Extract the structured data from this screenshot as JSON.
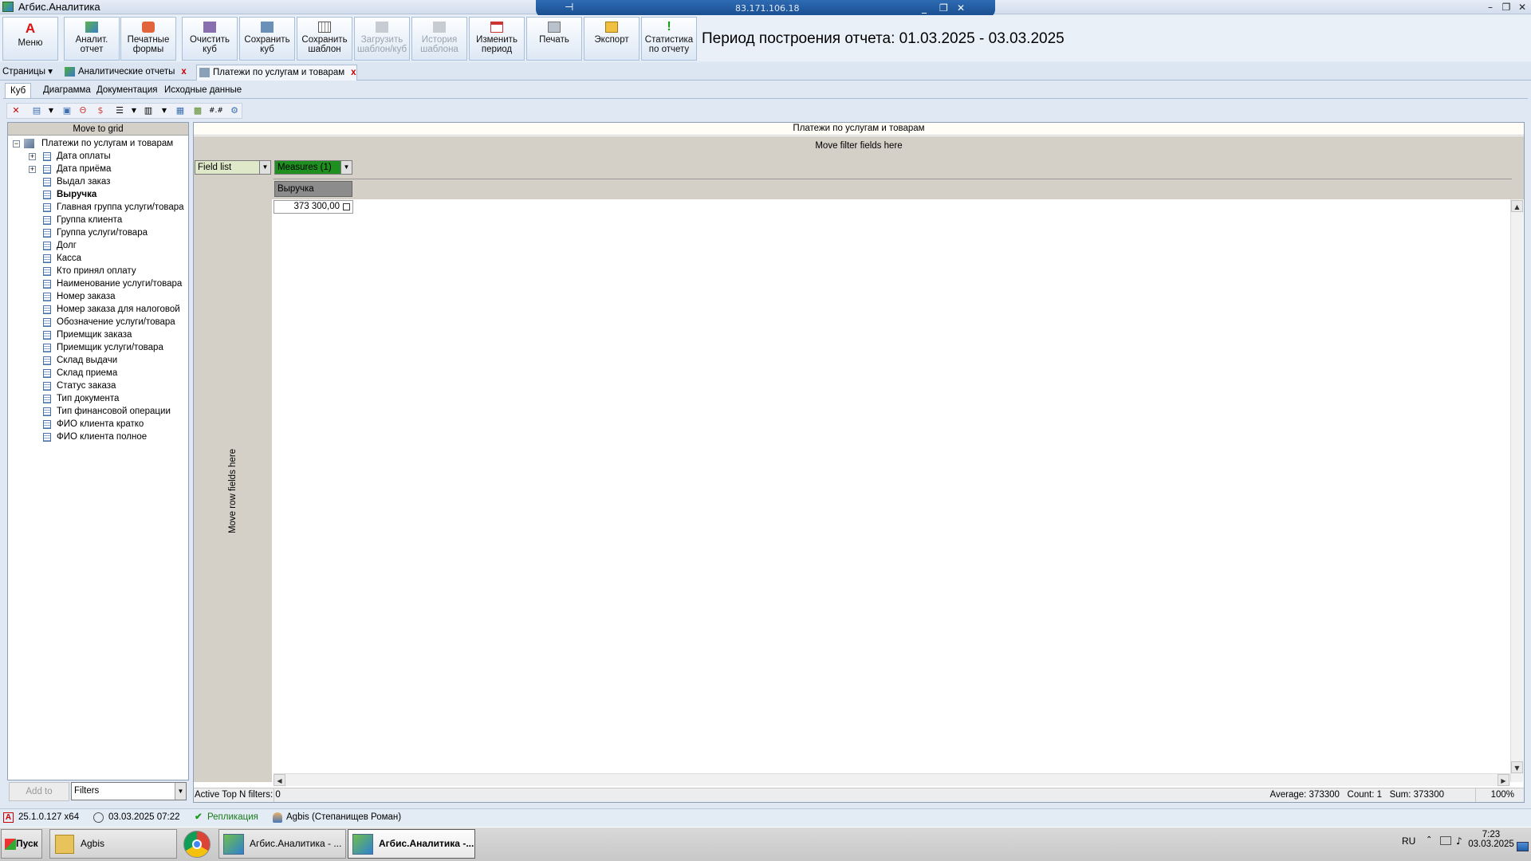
{
  "window": {
    "title": "Агбис.Аналитика",
    "min": "–",
    "max": "❐",
    "close": "✕"
  },
  "rdp": {
    "host": "83.171.106.18",
    "pin": "⊣",
    "min": "_",
    "restore": "❐",
    "close": "✕"
  },
  "ribbon": {
    "menu": "Меню",
    "analit_l1": "Аналит.",
    "analit_l2": "отчет",
    "print_forms_l1": "Печатные",
    "print_forms_l2": "формы",
    "clear_l1": "Очистить",
    "clear_l2": "куб",
    "save_cube_l1": "Сохранить",
    "save_cube_l2": "куб",
    "save_tpl_l1": "Сохранить",
    "save_tpl_l2": "шаблон",
    "load_l1": "Загрузить",
    "load_l2": "шаблон/куб",
    "hist_l1": "История",
    "hist_l2": "шаблона",
    "period_l1": "Изменить",
    "period_l2": "период",
    "print": "Печать",
    "export": "Экспорт",
    "stats_l1": "Статистика",
    "stats_l2": "по отчету",
    "period_text": "Период построения отчета: 01.03.2025 - 03.03.2025"
  },
  "pages": {
    "label": "Страницы",
    "tabs": [
      {
        "label": "Аналитические отчеты"
      },
      {
        "label": "Платежи по услугам и товарам"
      }
    ]
  },
  "subtabs": [
    "Куб",
    "Диаграмма",
    "Документация",
    "Исходные данные"
  ],
  "fieldlist": {
    "header": "Move to grid",
    "root": "Платежи по услугам и товарам",
    "fields": [
      "Дата оплаты",
      "Дата приёма",
      "Выдал заказ",
      "Выручка",
      "Главная группа услуги/товара",
      "Группа клиента",
      "Группа услуги/товара",
      "Долг",
      "Касса",
      "Кто принял оплату",
      "Наименование услуги/товара",
      "Номер заказа",
      "Номер заказа для налоговой",
      "Обозначение услуги/товара",
      "Приемщик заказа",
      "Приемщик услуги/товара",
      "Склад выдачи",
      "Склад приема",
      "Статус заказа",
      "Тип документа",
      "Тип финансовой операции",
      "ФИО клиента кратко",
      "ФИО клиента полное"
    ],
    "add_to": "Add to",
    "filter_select": "Filters"
  },
  "grid": {
    "title": "Платежи по услугам и товарам",
    "filter_hint": "Move filter fields here",
    "field_list_btn": "Field list",
    "measures_btn": "Measures (1)",
    "measure_header": "Выручка",
    "row_hint": "Move row fields here",
    "value": "373 300,00",
    "status_left": "Active Top N filters: 0",
    "status_right": "Average: 373300   Count: 1   Sum: 373300",
    "zoom": "100%"
  },
  "statusbar": {
    "version": "25.1.0.127 x64",
    "datetime": "03.03.2025 07:22",
    "replication": "Репликация",
    "user": "Agbis (Степанищев Роман)"
  },
  "taskbar": {
    "start": "Пуск",
    "folder": "Agbis",
    "app1": "Агбис.Аналитика - ...",
    "app2": "Агбис.Аналитика -...",
    "lang": "RU",
    "time": "7:23",
    "date": "03.03.2025"
  },
  "colors": {
    "measures": "#1f8f1f",
    "field_list": "#dfe8c8",
    "accent": "#2e6bb3",
    "close_x": "#cc0000"
  }
}
